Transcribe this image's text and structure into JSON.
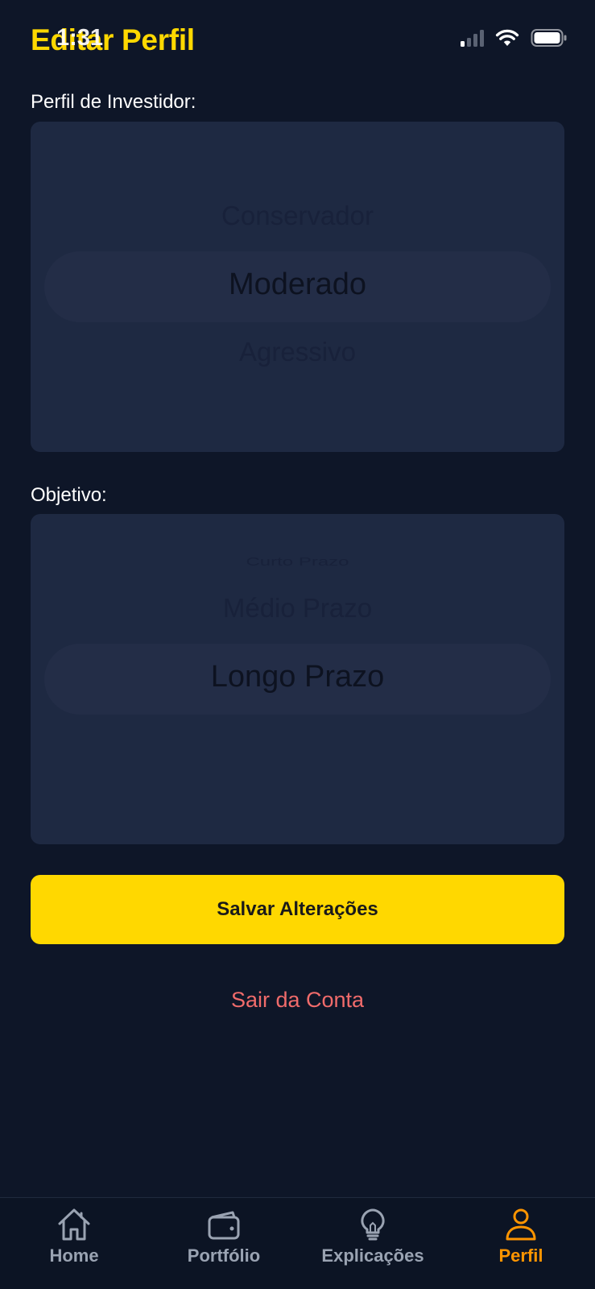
{
  "status_bar": {
    "time": "1:31"
  },
  "header": {
    "title": "Editar Perfil"
  },
  "investor_profile": {
    "label": "Perfil de Investidor:",
    "options": [
      "Conservador",
      "Moderado",
      "Agressivo"
    ],
    "selected": "Moderado"
  },
  "objective": {
    "label": "Objetivo:",
    "options": [
      "Curto Prazo",
      "Médio Prazo",
      "Longo Prazo"
    ],
    "selected": "Longo Prazo"
  },
  "actions": {
    "save_label": "Salvar Alterações",
    "logout_label": "Sair da Conta"
  },
  "tab_bar": {
    "items": [
      {
        "label": "Home",
        "icon": "home-icon"
      },
      {
        "label": "Portfólio",
        "icon": "wallet-icon"
      },
      {
        "label": "Explicações",
        "icon": "lightbulb-icon"
      },
      {
        "label": "Perfil",
        "icon": "user-icon"
      }
    ],
    "active": "Perfil"
  },
  "colors": {
    "accent": "#ffd800",
    "danger": "#f06b6b",
    "active_tab": "#ff9500",
    "background": "#0e1628",
    "picker_bg": "#1e2942"
  }
}
